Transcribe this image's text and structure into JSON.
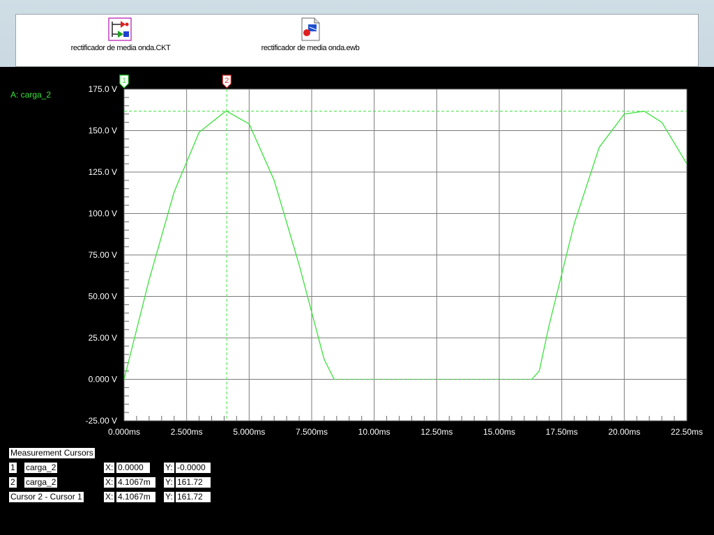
{
  "desktop": {
    "files": [
      {
        "name": "rectificador de media onda.CKT",
        "icon": "circuit-file-icon"
      },
      {
        "name": "rectificador de media onda.ewb",
        "icon": "ewb-file-icon"
      }
    ]
  },
  "plot": {
    "trace_label": "A: carga_2",
    "cursor_markers": [
      "1",
      "2"
    ],
    "colors": {
      "trace": "#39e339",
      "cursor1": "#39e339",
      "cursor2": "#e03030",
      "grid": "#7a7a7a",
      "background": "#ffffff"
    }
  },
  "chart_data": {
    "type": "line",
    "title": "",
    "xlabel": "",
    "ylabel": "",
    "xlim": [
      0,
      22.5
    ],
    "ylim": [
      -25,
      175
    ],
    "x_ticks": [
      "0.000ms",
      "2.500ms",
      "5.000ms",
      "7.500ms",
      "10.00ms",
      "12.50ms",
      "15.00ms",
      "17.50ms",
      "20.00ms",
      "22.50ms"
    ],
    "y_ticks": [
      "175.0 V",
      "150.0 V",
      "125.0 V",
      "100.0 V",
      "75.00 V",
      "50.00 V",
      "25.00 V",
      "0.000 V",
      "-25.00 V"
    ],
    "series": [
      {
        "name": "carga_2",
        "x": [
          0,
          1,
          2,
          3,
          4,
          4.1,
          5,
          6,
          7,
          8,
          8.4,
          16.3,
          16.6,
          17,
          18,
          19,
          20,
          20.8,
          21.5,
          22.5
        ],
        "y": [
          0,
          60,
          113,
          149,
          161,
          161.7,
          154,
          120,
          69,
          12,
          0,
          0,
          5,
          33,
          94,
          140,
          160,
          161.7,
          155,
          130
        ]
      }
    ],
    "cursors": [
      {
        "id": "1",
        "x": 0.0
      },
      {
        "id": "2",
        "x": 4.1067,
        "y": 161.72
      }
    ],
    "grid": true
  },
  "cursors_panel": {
    "title": "Measurement Cursors",
    "rows": [
      {
        "id": "1",
        "trace": "carga_2",
        "x_label": "X:",
        "x": "0.0000",
        "y_label": "Y:",
        "y": "-0.0000"
      },
      {
        "id": "2",
        "trace": "carga_2",
        "x_label": "X:",
        "x": "4.1067m",
        "y_label": "Y:",
        "y": "161.72"
      },
      {
        "id": "",
        "trace": "Cursor 2 - Cursor 1",
        "x_label": "X:",
        "x": "4.1067m",
        "y_label": "Y:",
        "y": "161.72"
      }
    ]
  }
}
